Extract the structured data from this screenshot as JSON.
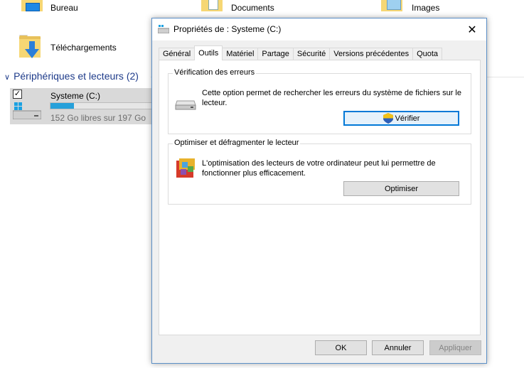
{
  "explorer": {
    "folders": [
      {
        "label": "Bureau"
      },
      {
        "label": "Documents"
      },
      {
        "label": "Images"
      },
      {
        "label": "Téléchargements"
      }
    ],
    "group_header": "Périphériques et lecteurs (2)",
    "drive": {
      "name": "Systeme (C:)",
      "free_text": "152 Go libres sur 197 Go",
      "used_fraction": 0.23
    }
  },
  "dialog": {
    "title": "Propriétés de : Systeme (C:)",
    "tabs": [
      {
        "label": "Général"
      },
      {
        "label": "Outils"
      },
      {
        "label": "Matériel"
      },
      {
        "label": "Partage"
      },
      {
        "label": "Sécurité"
      },
      {
        "label": "Versions précédentes"
      },
      {
        "label": "Quota"
      }
    ],
    "active_tab": "Outils",
    "error_check": {
      "title": "Vérification des erreurs",
      "description_line1": "Cette option permet de rechercher les erreurs du système de fichiers sur le",
      "description_line2": "lecteur.",
      "button": "Vérifier"
    },
    "optimize": {
      "title": "Optimiser et défragmenter le lecteur",
      "description_line1": "L'optimisation des lecteurs de votre ordinateur peut lui permettre de",
      "description_line2": "fonctionner plus efficacement.",
      "button": "Optimiser"
    },
    "footer": {
      "ok": "OK",
      "cancel": "Annuler",
      "apply": "Appliquer"
    }
  },
  "colors": {
    "accent": "#0078d7",
    "group_header": "#1e3b8a",
    "drive_bar": "#26a0da"
  }
}
